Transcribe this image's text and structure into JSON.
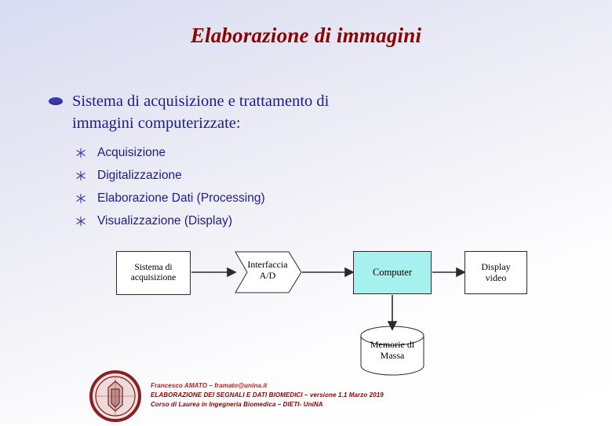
{
  "slide": {
    "title": "Elaborazione di immagini",
    "bullet_main": {
      "line1": "Sistema   di   acquisizione   e   trattamento   di",
      "line2": "immagini computerizzate:",
      "marker": "oval-bullet"
    },
    "sub_items": [
      {
        "label": "Acquisizione",
        "marker": "star-bullet"
      },
      {
        "label": "Digitalizzazione",
        "marker": "star-bullet"
      },
      {
        "label": "Elaborazione Dati (Processing)",
        "marker": "star-bullet"
      },
      {
        "label": "Visualizzazione (Display)",
        "marker": "star-bullet"
      }
    ],
    "diagram": {
      "boxes": [
        {
          "id": "acquisizione",
          "line1": "Sistema di",
          "line2": "acquisizione",
          "shape": "rect",
          "fill": "#ffffff"
        },
        {
          "id": "interfaccia",
          "line1": "Interfaccia",
          "line2": "A/D",
          "shape": "chevron",
          "fill": "#ffffff"
        },
        {
          "id": "computer",
          "line1": "Computer",
          "line2": "",
          "shape": "rect",
          "fill": "#a6f0ee"
        },
        {
          "id": "display",
          "line1": "Display",
          "line2": "video",
          "shape": "rect",
          "fill": "#ffffff"
        },
        {
          "id": "memorie",
          "line1": "Memorie di",
          "line2": "Massa",
          "shape": "cylinder",
          "fill": "#ffffff"
        }
      ]
    },
    "footer": {
      "line1": "Francesco AMATO – framato@unina.it",
      "line2": "ELABORAZIONE DEI SEGNALI E DATI BIOMEDICI – versione 1.1 Marzo 2019",
      "line3": "Corso di Laurea in Ingegneria Biomedica – DIETI- UniNA",
      "logo": "university-crest-logo"
    },
    "colors": {
      "title": "#8b0000",
      "body_text": "#1c1c8c",
      "computer_fill": "#a6f0ee",
      "footer": "#8b0000"
    }
  }
}
